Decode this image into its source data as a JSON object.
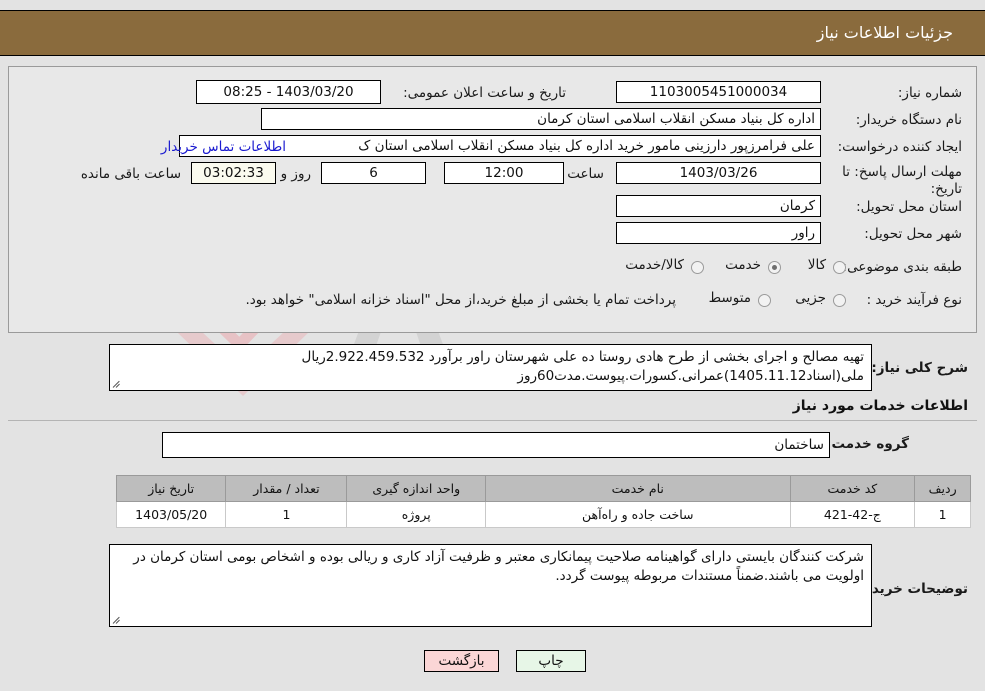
{
  "header": {
    "title": "جزئیات اطلاعات نیاز"
  },
  "watermark": {
    "text": "AriaTender.net",
    "shield_icon": "shield-check-icon"
  },
  "form": {
    "need_number": {
      "label": "شماره نیاز:",
      "value": "1103005451000034"
    },
    "announce_datetime": {
      "label": "تاریخ و ساعت اعلان عمومی:",
      "value": "1403/03/20 - 08:25"
    },
    "buyer_org": {
      "label": "نام دستگاه خریدار:",
      "value": "اداره کل بنیاد مسکن انقلاب اسلامی استان کرمان"
    },
    "request_creator": {
      "label": "ایجاد کننده درخواست:",
      "value": "علی فرامرزپور دارزینی مامور خرید اداره کل بنیاد مسکن انقلاب اسلامی استان ک"
    },
    "contact_link": {
      "label": "اطلاعات تماس خریدار"
    },
    "deadline": {
      "label": "مهلت ارسال پاسخ: تا تاریخ:",
      "date": "1403/03/26",
      "hour_label": "ساعت",
      "hour": "12:00",
      "days": "6",
      "days_label": "روز و",
      "countdown": "03:02:33",
      "remaining_label": "ساعت باقی مانده"
    },
    "delivery_province": {
      "label": "استان محل تحویل:",
      "value": "کرمان"
    },
    "delivery_city": {
      "label": "شهر محل تحویل:",
      "value": "راور"
    },
    "category": {
      "label": "طبقه بندی موضوعی:",
      "options": [
        "کالا",
        "خدمت",
        "کالا/خدمت"
      ],
      "selected": "خدمت"
    },
    "purchase_process": {
      "label": "نوع فرآیند خرید :",
      "options": [
        "جزیی",
        "متوسط"
      ],
      "selected": "",
      "note": "پرداخت تمام یا بخشی از مبلغ خرید،از محل \"اسناد خزانه اسلامی\" خواهد بود."
    }
  },
  "need_description": {
    "label": "شرح کلی نیاز:",
    "value": "تهیه مصالح و اجرای بخشی از طرح هادی روستا ده علی شهرستان راور برآورد 2.922.459.532ریال ملی(اسناد1405.11.12)عمرانی.کسورات.پیوست.مدت60روز"
  },
  "services_section": {
    "heading": "اطلاعات خدمات مورد نیاز",
    "service_group": {
      "label": "گروه خدمت:",
      "value": "ساختمان"
    },
    "table": {
      "columns": [
        "ردیف",
        "کد خدمت",
        "نام خدمت",
        "واحد اندازه گیری",
        "تعداد / مقدار",
        "تاریخ نیاز"
      ],
      "rows": [
        {
          "row": "1",
          "code": "ج-42-421",
          "name": "ساخت جاده و راه‌آهن",
          "unit": "پروژه",
          "qty": "1",
          "date": "1403/05/20"
        }
      ]
    }
  },
  "buyer_notes": {
    "label": "توضیحات خریدار:",
    "value": "شرکت کنندگان بایستی دارای گواهینامه صلاحیت پیمانکاری معتبر و ظرفیت آزاد کاری و ریالی بوده و اشخاص بومی استان کرمان در اولویت می باشند.ضمناً مستندات مربوطه پیوست گردد."
  },
  "footer": {
    "print_button": "چاپ",
    "back_button": "بازگشت"
  }
}
